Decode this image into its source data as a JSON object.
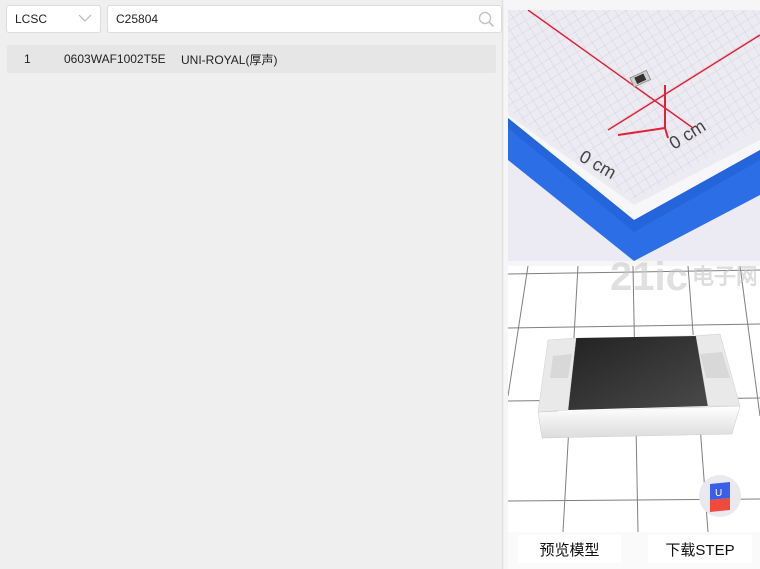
{
  "toolbar": {
    "source_select": {
      "selected": "LCSC"
    },
    "search": {
      "value": "C25804"
    }
  },
  "results": [
    {
      "index": "1",
      "part_number": "0603WAF1002T5E",
      "manufacturer": "UNI-ROYAL(厚声)"
    }
  ],
  "preview": {
    "photo": {
      "ruler_labels": [
        "0 cm",
        "0 cm"
      ]
    },
    "buttons": {
      "preview_model": "预览模型",
      "download_step": "下载STEP"
    }
  },
  "watermark": {
    "text": "电子网"
  },
  "colors": {
    "accent_blue": "#2b6ee6",
    "ruler_red": "#e0223a",
    "cube_blue": "#3b5ee8",
    "cube_red": "#ef4b3c"
  }
}
